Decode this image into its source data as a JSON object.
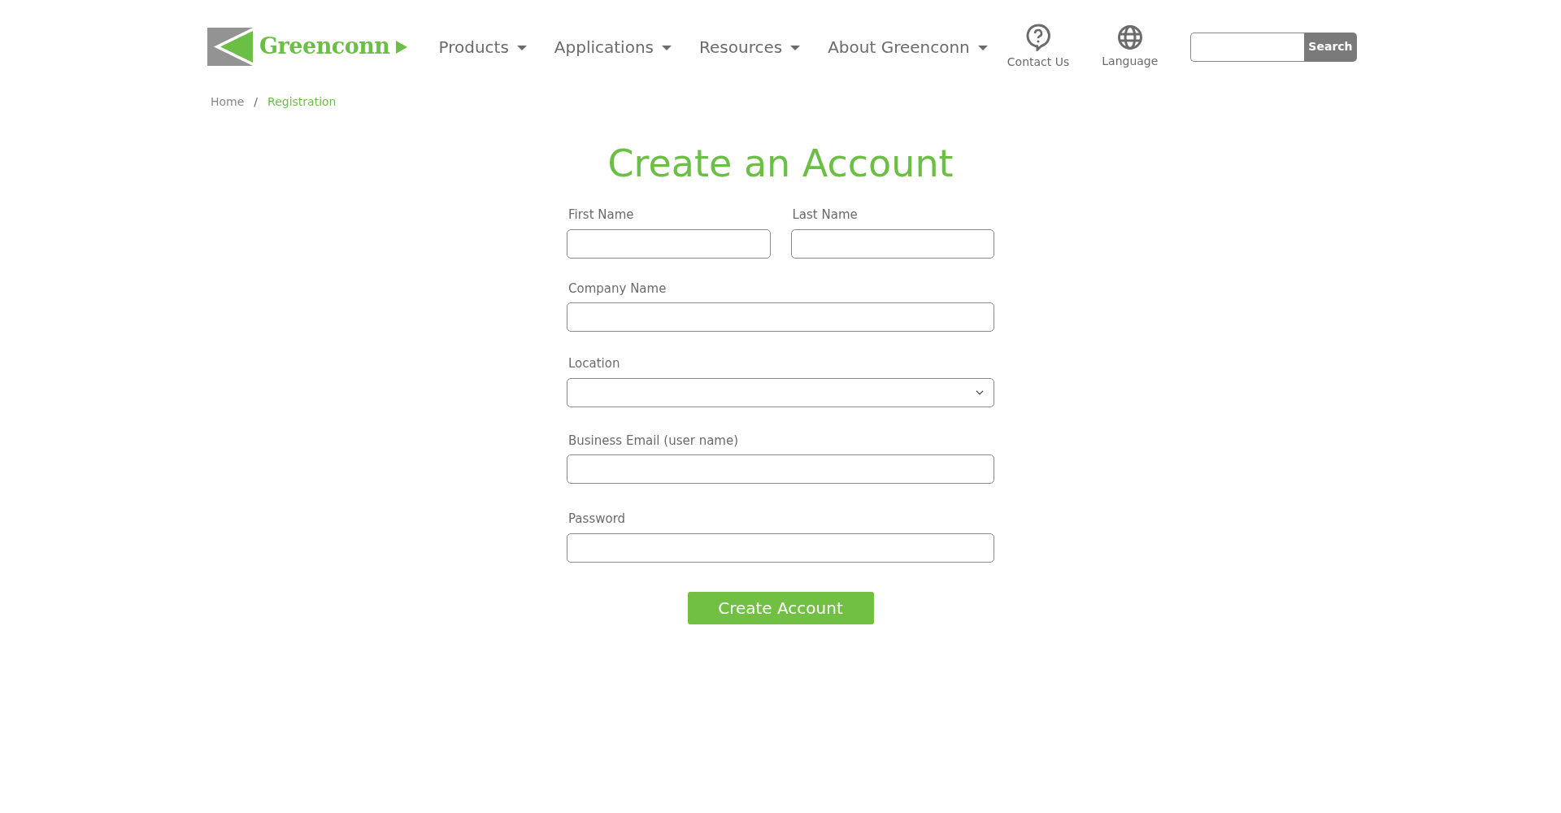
{
  "logo": {
    "text": "Greenconn"
  },
  "nav": [
    {
      "label": "Products",
      "dropdown": true
    },
    {
      "label": "Applications",
      "dropdown": true
    },
    {
      "label": "Resources",
      "dropdown": true
    },
    {
      "label": "About Greenconn",
      "dropdown": true
    }
  ],
  "utility_links": [
    {
      "label": "Contact Us",
      "kind": "help"
    },
    {
      "label": "Language",
      "kind": "globe"
    }
  ],
  "search": {
    "button": "Search"
  },
  "breadcrumb": {
    "separator": "/",
    "items": [
      {
        "label": "Home",
        "selected": false
      },
      {
        "label": "Registration",
        "selected": true
      }
    ]
  },
  "title": "Create an Account",
  "form": {
    "rows": [
      [
        {
          "label": "First Name",
          "kind": "text"
        },
        {
          "label": "Last Name",
          "kind": "text"
        }
      ],
      [
        {
          "label": "Company Name",
          "kind": "text"
        }
      ],
      [
        {
          "label": "Location",
          "kind": "select"
        }
      ],
      [
        {
          "label": "Business Email (user name)",
          "kind": "email"
        }
      ],
      [
        {
          "label": "Password",
          "kind": "password"
        }
      ]
    ],
    "submit": "Create Account"
  }
}
